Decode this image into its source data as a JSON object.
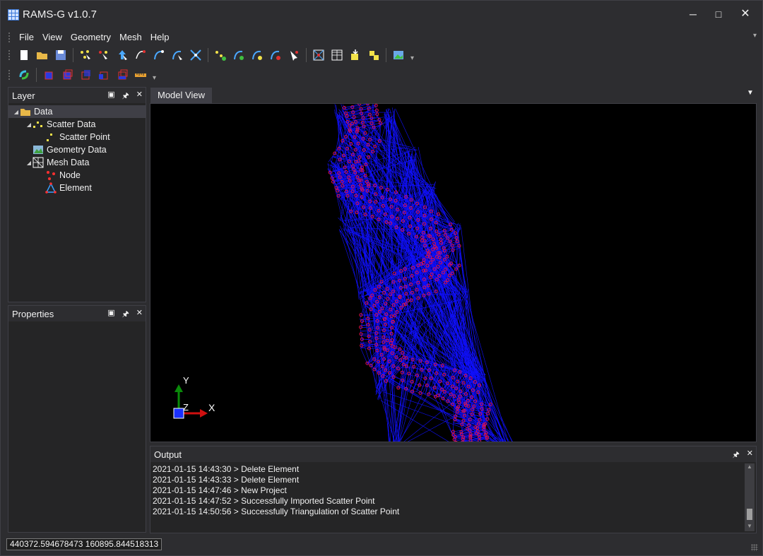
{
  "window": {
    "title": "RAMS-G v1.0.7"
  },
  "menu": [
    "File",
    "View",
    "Geometry",
    "Mesh",
    "Help"
  ],
  "toolbar1": [
    "new-icon",
    "open-icon",
    "save-icon",
    "sep",
    "scatter-add-icon",
    "scatter-select-icon",
    "scatter-move-icon",
    "scatter-delete-icon",
    "arc-create-icon",
    "arc-edit-icon",
    "arc-delete-icon",
    "sep",
    "scatter-gen-icon",
    "arc-gen-icon",
    "arc-redist-icon",
    "arc-split-icon",
    "select-tool-icon",
    "sep",
    "mesh-icon",
    "grid-icon",
    "mesh-import-icon",
    "mesh-export-icon",
    "sep",
    "image-icon"
  ],
  "toolbar2": [
    "refresh-icon",
    "sep",
    "cube-view-1-icon",
    "cube-view-2-icon",
    "cube-view-3-icon",
    "cube-view-4-icon",
    "cube-view-5-icon",
    "ruler-icon"
  ],
  "layer_panel": {
    "title": "Layer",
    "tree": [
      {
        "label": "Data",
        "level": 0,
        "expanded": true,
        "icon": "folder-icon",
        "selected": true
      },
      {
        "label": "Scatter Data",
        "level": 1,
        "expanded": true,
        "icon": "scatter-data-icon"
      },
      {
        "label": "Scatter Point",
        "level": 2,
        "icon": "scatter-point-icon"
      },
      {
        "label": "Geometry Data",
        "level": 1,
        "icon": "geometry-data-icon"
      },
      {
        "label": "Mesh Data",
        "level": 1,
        "expanded": true,
        "icon": "mesh-data-icon"
      },
      {
        "label": "Node",
        "level": 2,
        "icon": "node-icon"
      },
      {
        "label": "Element",
        "level": 2,
        "icon": "element-icon"
      }
    ]
  },
  "properties_panel": {
    "title": "Properties"
  },
  "model_view": {
    "tab": "Model View",
    "axes": {
      "y": "Y",
      "z": "Z",
      "x": "X"
    },
    "colors": {
      "mesh": "#1010ff",
      "node": "#e0104a",
      "background": "#000000"
    }
  },
  "output_panel": {
    "title": "Output",
    "lines": [
      "2021-01-15 14:43:30 > Delete Element",
      "2021-01-15 14:43:33 > Delete Element",
      "2021-01-15 14:47:46 > New Project",
      "2021-01-15 14:47:52 > Successfully Imported Scatter Point",
      "2021-01-15 14:50:56 > Successfully Triangulation of Scatter Point"
    ]
  },
  "status": {
    "coordinates": "440372.594678473  160895.844518313"
  }
}
